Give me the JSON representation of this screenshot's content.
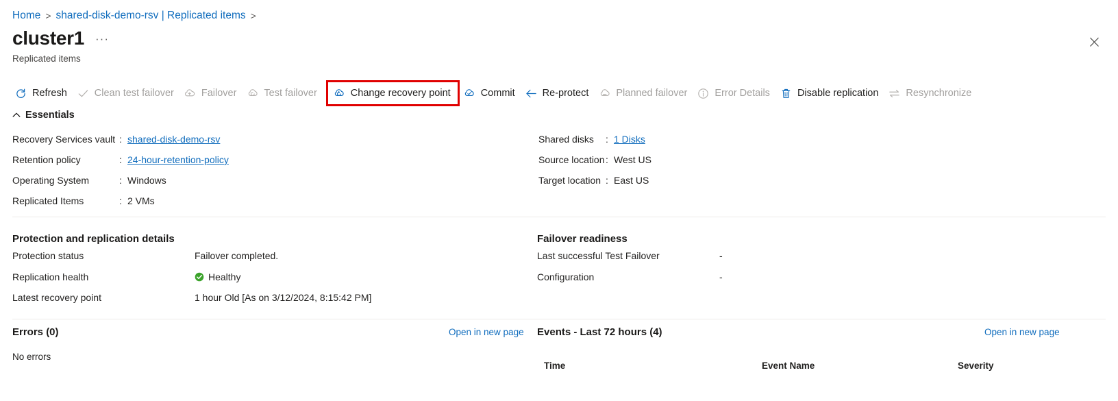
{
  "breadcrumb": {
    "items": [
      {
        "label": "Home",
        "type": "link"
      },
      {
        "label": ">",
        "type": "sep"
      },
      {
        "label": "shared-disk-demo-rsv | Replicated items",
        "type": "link"
      },
      {
        "label": ">",
        "type": "sep"
      }
    ]
  },
  "header": {
    "title": "cluster1",
    "ellipsis": "···",
    "subtitle": "Replicated items",
    "close_icon": "close-icon"
  },
  "toolbar": {
    "items": [
      {
        "label": "Refresh",
        "icon": "refresh-icon",
        "disabled": false,
        "highlighted": false
      },
      {
        "label": "Clean test failover",
        "icon": "checkmark-icon",
        "disabled": true,
        "highlighted": false
      },
      {
        "label": "Failover",
        "icon": "cloud-failover-icon",
        "disabled": true,
        "highlighted": false
      },
      {
        "label": "Test failover",
        "icon": "cloud-test-failover-icon",
        "disabled": true,
        "highlighted": false
      },
      {
        "label": "Change recovery point",
        "icon": "cloud-recovery-point-icon",
        "disabled": false,
        "highlighted": true
      },
      {
        "label": "Commit",
        "icon": "cloud-commit-icon",
        "disabled": false,
        "highlighted": false
      },
      {
        "label": "Re-protect",
        "icon": "arrow-left-icon",
        "disabled": false,
        "highlighted": false
      },
      {
        "label": "Planned failover",
        "icon": "cloud-planned-failover-icon",
        "disabled": true,
        "highlighted": false
      },
      {
        "label": "Error Details",
        "icon": "info-icon",
        "disabled": true,
        "highlighted": false
      },
      {
        "label": "Disable replication",
        "icon": "trash-icon",
        "disabled": false,
        "highlighted": false
      },
      {
        "label": "Resynchronize",
        "icon": "sync-arrows-icon",
        "disabled": true,
        "highlighted": false
      }
    ],
    "highlight_color": "#e00000"
  },
  "essentials": {
    "header": "Essentials",
    "collapse_icon": "chevron-up-icon",
    "left": [
      {
        "key": "Recovery Services vault",
        "colon": ":",
        "value": "shared-disk-demo-rsv",
        "link": true
      },
      {
        "key": "Retention policy",
        "colon": ":",
        "value": "24-hour-retention-policy",
        "link": true
      },
      {
        "key": "Operating System",
        "colon": ":",
        "value": "Windows",
        "link": false
      },
      {
        "key": "Replicated Items",
        "colon": ":",
        "value": "2 VMs",
        "link": false
      }
    ],
    "right": [
      {
        "key": "Shared disks",
        "colon": ":",
        "value": "1 Disks",
        "link": true
      },
      {
        "key": "Source location",
        "colon": ":",
        "value": "West US",
        "link": false
      },
      {
        "key": "Target location",
        "colon": ":",
        "value": "East US",
        "link": false
      }
    ]
  },
  "protection": {
    "title": "Protection and replication details",
    "rows": [
      {
        "key": "Protection status",
        "value": "Failover completed.",
        "icon": null
      },
      {
        "key": "Replication health",
        "value": "Healthy",
        "icon": "health-check-icon"
      },
      {
        "key": "Latest recovery point",
        "value": "1 hour Old [As on 3/12/2024, 8:15:42 PM]",
        "icon": null
      }
    ],
    "health_color": "#3ba32b"
  },
  "failover_readiness": {
    "title": "Failover readiness",
    "rows": [
      {
        "key": "Last successful Test Failover",
        "value": "-"
      },
      {
        "key": "Configuration",
        "value": "-"
      }
    ]
  },
  "errors_panel": {
    "title": "Errors (0)",
    "open_link": "Open in new page",
    "empty_text": "No errors"
  },
  "events_panel": {
    "title": "Events - Last 72 hours (4)",
    "open_link": "Open in new page",
    "columns": [
      "Time",
      "Event Name",
      "Severity"
    ]
  },
  "colors": {
    "link": "#0f6cbd",
    "text": "#201f1e",
    "disabled": "#a19f9d",
    "divider": "#edebe9"
  }
}
